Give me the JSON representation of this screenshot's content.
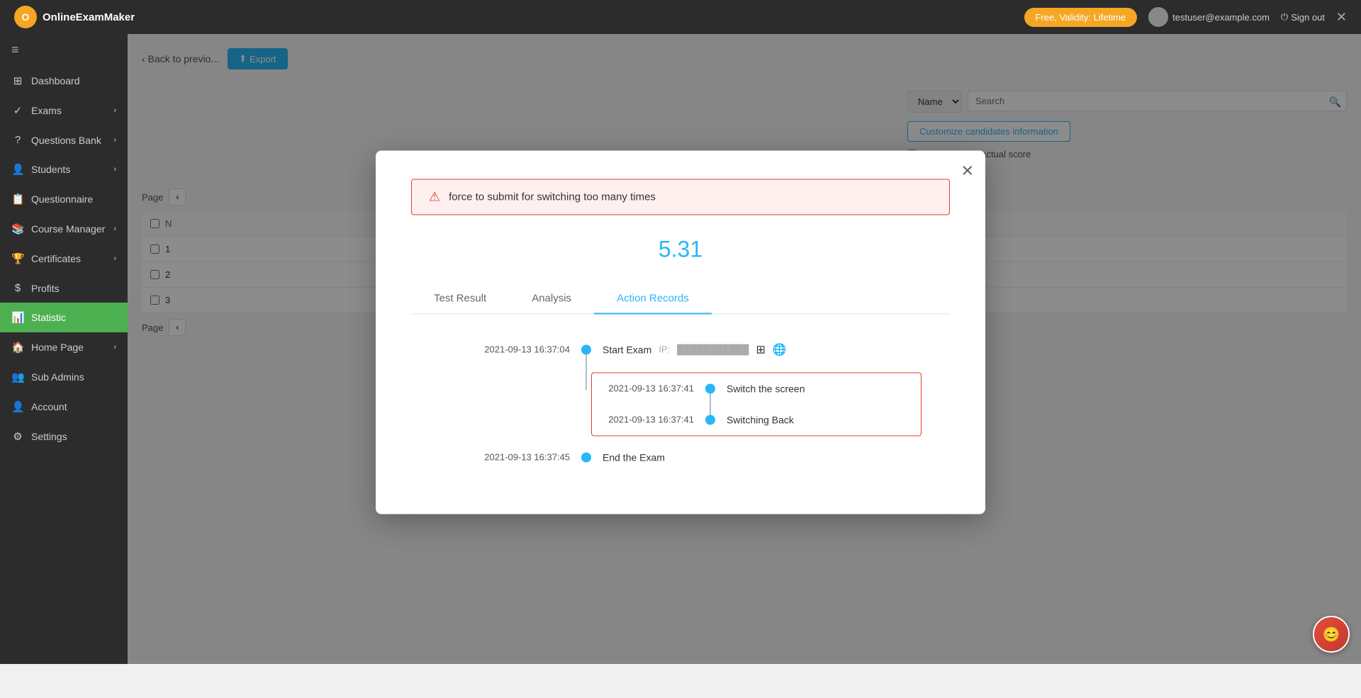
{
  "app": {
    "name": "OnlineExamMaker",
    "logo_letter": "O"
  },
  "navbar": {
    "plan_label": "Free, Validity: Lifetime",
    "user_name": "testuser@example.com",
    "sign_out_label": "Sign out"
  },
  "sidebar": {
    "toggle_icon": "≡",
    "items": [
      {
        "id": "dashboard",
        "label": "Dashboard",
        "icon": "⊞",
        "has_arrow": false
      },
      {
        "id": "exams",
        "label": "Exams",
        "icon": "✓",
        "has_arrow": true
      },
      {
        "id": "questions-bank",
        "label": "Questions Bank",
        "icon": "?",
        "has_arrow": true
      },
      {
        "id": "students",
        "label": "Students",
        "icon": "👤",
        "has_arrow": true
      },
      {
        "id": "questionnaire",
        "label": "Questionnaire",
        "icon": "📋",
        "has_arrow": false
      },
      {
        "id": "course-manager",
        "label": "Course Manager",
        "icon": "📚",
        "has_arrow": true
      },
      {
        "id": "certificates",
        "label": "Certificates",
        "icon": "🏆",
        "has_arrow": true
      },
      {
        "id": "profits",
        "label": "Profits",
        "icon": "$",
        "has_arrow": false
      },
      {
        "id": "statistic",
        "label": "Statistic",
        "icon": "📊",
        "has_arrow": false,
        "active": true
      },
      {
        "id": "homepage",
        "label": "Home Page",
        "icon": "🏠",
        "has_arrow": true
      },
      {
        "id": "sub-admins",
        "label": "Sub Admins",
        "icon": "👥",
        "has_arrow": false
      },
      {
        "id": "account",
        "label": "Account",
        "icon": "👤",
        "has_arrow": false
      },
      {
        "id": "settings",
        "label": "Settings",
        "icon": "⚙",
        "has_arrow": false
      }
    ]
  },
  "main": {
    "back_label": "Back to previo...",
    "export_label": "Export",
    "page_label": "Page",
    "search_placeholder": "Search",
    "customize_btn_label": "Customize candidates information",
    "show_score_label": "Show only the actual score",
    "table_columns": [
      "N",
      ""
    ],
    "table_rows": [
      {
        "num": "1",
        "col2": ""
      },
      {
        "num": "2",
        "col2": ""
      },
      {
        "num": "3",
        "col2": ""
      }
    ]
  },
  "modal": {
    "close_icon": "✕",
    "alert_message": "force to submit for switching too many times",
    "alert_icon": "▲",
    "score": "5.31",
    "tabs": [
      {
        "id": "test-result",
        "label": "Test Result",
        "active": false
      },
      {
        "id": "analysis",
        "label": "Analysis",
        "active": false
      },
      {
        "id": "action-records",
        "label": "Action Records",
        "active": true
      }
    ],
    "timeline": [
      {
        "date": "2021-09-13 16:37:04",
        "action": "Start Exam",
        "ip_prefix": "IP:",
        "ip_value": "███████████",
        "os_icon": "⊞",
        "browser_icon": "🌐",
        "highlight": false
      },
      {
        "date": "2021-09-13 16:37:41",
        "action": "Switch the screen",
        "highlight": true
      },
      {
        "date": "2021-09-13 16:37:41",
        "action": "Switching Back",
        "highlight": true
      },
      {
        "date": "2021-09-13 16:37:45",
        "action": "End the Exam",
        "highlight": false
      }
    ]
  }
}
